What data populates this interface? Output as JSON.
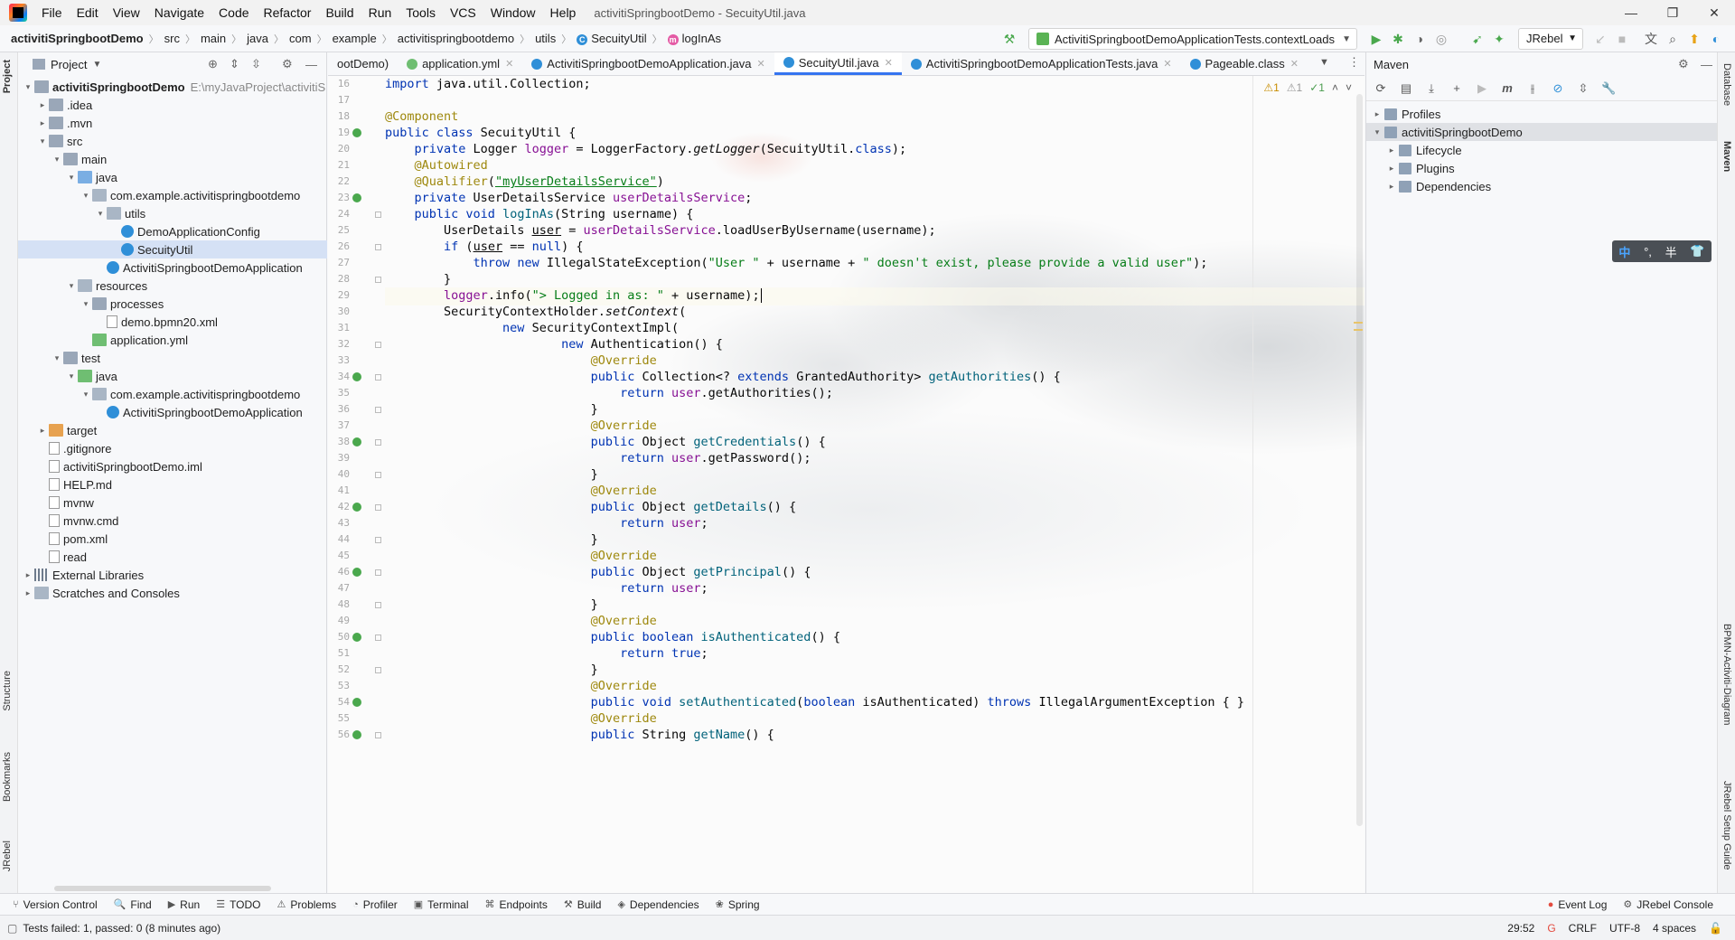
{
  "menubar": {
    "items": [
      "File",
      "Edit",
      "View",
      "Navigate",
      "Code",
      "Refactor",
      "Build",
      "Run",
      "Tools",
      "VCS",
      "Window",
      "Help"
    ],
    "title": "activitiSpringbootDemo - SecuityUtil.java",
    "win_min": "—",
    "win_max": "❐",
    "win_close": "✕"
  },
  "navbar": {
    "crumbs": [
      "activitiSpringbootDemo",
      "src",
      "main",
      "java",
      "com",
      "example",
      "activitispringbootdemo",
      "utils",
      "SecuityUtil",
      "logInAs"
    ],
    "run_config": "ActivitiSpringbootDemoApplicationTests.contextLoads",
    "jrebel": "JRebel"
  },
  "left_stripe": {
    "project": "Project",
    "structure": "Structure",
    "bookmarks": "Bookmarks",
    "jrebel": "JRebel"
  },
  "project": {
    "title": "Project",
    "tree": [
      {
        "label": "activitiSpringbootDemo",
        "extra": "E:\\myJavaProject\\activitiS",
        "indent": 0,
        "arrow": "▾",
        "icon": "f-folder",
        "bold": true
      },
      {
        "label": ".idea",
        "indent": 1,
        "arrow": "▸",
        "icon": "f-folder"
      },
      {
        "label": ".mvn",
        "indent": 1,
        "arrow": "▸",
        "icon": "f-folder"
      },
      {
        "label": "src",
        "indent": 1,
        "arrow": "▾",
        "icon": "f-folder"
      },
      {
        "label": "main",
        "indent": 2,
        "arrow": "▾",
        "icon": "f-folder"
      },
      {
        "label": "java",
        "indent": 3,
        "arrow": "▾",
        "icon": "f-src"
      },
      {
        "label": "com.example.activitispringbootdemo",
        "indent": 4,
        "arrow": "▾",
        "icon": "f-pkg"
      },
      {
        "label": "utils",
        "indent": 5,
        "arrow": "▾",
        "icon": "f-pkg"
      },
      {
        "label": "DemoApplicationConfig",
        "indent": 6,
        "arrow": "",
        "icon": "f-cls"
      },
      {
        "label": "SecuityUtil",
        "indent": 6,
        "arrow": "",
        "icon": "f-cls",
        "selected": true
      },
      {
        "label": "ActivitiSpringbootDemoApplication",
        "indent": 5,
        "arrow": "",
        "icon": "f-cls"
      },
      {
        "label": "resources",
        "indent": 3,
        "arrow": "▾",
        "icon": "f-pkg"
      },
      {
        "label": "processes",
        "indent": 4,
        "arrow": "▾",
        "icon": "f-folder"
      },
      {
        "label": "demo.bpmn20.xml",
        "indent": 5,
        "arrow": "",
        "icon": "f-file"
      },
      {
        "label": "application.yml",
        "indent": 4,
        "arrow": "",
        "icon": "f-green"
      },
      {
        "label": "test",
        "indent": 2,
        "arrow": "▾",
        "icon": "f-folder"
      },
      {
        "label": "java",
        "indent": 3,
        "arrow": "▾",
        "icon": "f-green"
      },
      {
        "label": "com.example.activitispringbootdemo",
        "indent": 4,
        "arrow": "▾",
        "icon": "f-pkg"
      },
      {
        "label": "ActivitiSpringbootDemoApplication",
        "indent": 5,
        "arrow": "",
        "icon": "f-cls"
      },
      {
        "label": "target",
        "indent": 1,
        "arrow": "▸",
        "icon": "f-orange"
      },
      {
        "label": ".gitignore",
        "indent": 1,
        "arrow": "",
        "icon": "f-file"
      },
      {
        "label": "activitiSpringbootDemo.iml",
        "indent": 1,
        "arrow": "",
        "icon": "f-file"
      },
      {
        "label": "HELP.md",
        "indent": 1,
        "arrow": "",
        "icon": "f-file"
      },
      {
        "label": "mvnw",
        "indent": 1,
        "arrow": "",
        "icon": "f-file"
      },
      {
        "label": "mvnw.cmd",
        "indent": 1,
        "arrow": "",
        "icon": "f-file"
      },
      {
        "label": "pom.xml",
        "indent": 1,
        "arrow": "",
        "icon": "f-file"
      },
      {
        "label": "read",
        "indent": 1,
        "arrow": "",
        "icon": "f-file"
      },
      {
        "label": "External Libraries",
        "indent": 0,
        "arrow": "▸",
        "icon": "f-lib"
      },
      {
        "label": "Scratches and Consoles",
        "indent": 0,
        "arrow": "▸",
        "icon": "f-pkg"
      }
    ]
  },
  "tabs": [
    {
      "label": "ootDemo)",
      "color": "",
      "active": false,
      "close": false
    },
    {
      "label": "application.yml",
      "color": "#6fbe72",
      "active": false,
      "close": true
    },
    {
      "label": "ActivitiSpringbootDemoApplication.java",
      "color": "#2f8fd8",
      "active": false,
      "close": true
    },
    {
      "label": "SecuityUtil.java",
      "color": "#2f8fd8",
      "active": true,
      "close": true
    },
    {
      "label": "ActivitiSpringbootDemoApplicationTests.java",
      "color": "#2f8fd8",
      "active": false,
      "close": true
    },
    {
      "label": "Pageable.class",
      "color": "#2f8fd8",
      "active": false,
      "close": true
    }
  ],
  "inspections": {
    "warn1": "⚠1",
    "warn2": "⚠1",
    "ok": "✓1"
  },
  "editor": {
    "lines": [
      {
        "n": "16",
        "html": "<span class=\"kw\">import</span> java.util.Collection;"
      },
      {
        "n": "17",
        "html": ""
      },
      {
        "n": "18",
        "html": "<span class=\"an\">@Component</span>"
      },
      {
        "n": "19",
        "html": "<span class=\"kw\">public class</span> SecuityUtil {",
        "mark": "#4aa84d"
      },
      {
        "n": "20",
        "html": "    <span class=\"kw\">private</span> Logger <span class=\"fd\">logger</span> = LoggerFactory.<span class=\"it\">getLogger</span>(SecuityUtil.<span class=\"kw\">class</span>);"
      },
      {
        "n": "21",
        "html": "    <span class=\"an\">@Autowired</span>"
      },
      {
        "n": "22",
        "html": "    <span class=\"an\">@Qualifier</span>(<span class=\"st ul\">\"myUserDetailsService\"</span>)"
      },
      {
        "n": "23",
        "html": "    <span class=\"kw\">private</span> UserDetailsService <span class=\"fd\">userDetailsService</span>;",
        "mark": "#4aa84d"
      },
      {
        "n": "24",
        "html": "    <span class=\"kw\">public void</span> <span class=\"fn\">logInAs</span>(String username) {",
        "fold": true
      },
      {
        "n": "25",
        "html": "        UserDetails <span class=\"ul\">user</span> = <span class=\"fd\">userDetailsService</span>.loadUserByUsername(username);"
      },
      {
        "n": "26",
        "html": "        <span class=\"kw\">if</span> (<span class=\"ul\">user</span> == <span class=\"kw\">null</span>) {",
        "fold": true
      },
      {
        "n": "27",
        "html": "            <span class=\"kw\">throw new</span> IllegalStateException(<span class=\"st\">\"User \"</span> + username + <span class=\"st\">\" doesn't exist, please provide a valid user\"</span>);"
      },
      {
        "n": "28",
        "html": "        }",
        "fold": true
      },
      {
        "n": "29",
        "html": "        <span class=\"fd\">logger</span>.info(<span class=\"st\">\"> Logged in as: \"</span> + username);",
        "caret": true
      },
      {
        "n": "30",
        "html": "        SecurityContextHolder.<span class=\"it\">setContext</span>("
      },
      {
        "n": "31",
        "html": "                <span class=\"kw\">new</span> SecurityContextImpl("
      },
      {
        "n": "32",
        "html": "                        <span class=\"kw\">new</span> Authentication() {",
        "fold": true
      },
      {
        "n": "33",
        "html": "                            <span class=\"an\">@Override</span>"
      },
      {
        "n": "34",
        "html": "                            <span class=\"kw\">public</span> Collection&lt;? <span class=\"kw\">extends</span> GrantedAuthority&gt; <span class=\"fn\">getAuthorities</span>() {",
        "mark": "#4aa84d",
        "fold": true
      },
      {
        "n": "35",
        "html": "                                <span class=\"kw\">return</span> <span class=\"fd\">user</span>.getAuthorities();"
      },
      {
        "n": "36",
        "html": "                            }",
        "fold": true
      },
      {
        "n": "37",
        "html": "                            <span class=\"an\">@Override</span>"
      },
      {
        "n": "38",
        "html": "                            <span class=\"kw\">public</span> Object <span class=\"fn\">getCredentials</span>() {",
        "mark": "#4aa84d",
        "fold": true
      },
      {
        "n": "39",
        "html": "                                <span class=\"kw\">return</span> <span class=\"fd\">user</span>.getPassword();"
      },
      {
        "n": "40",
        "html": "                            }",
        "fold": true
      },
      {
        "n": "41",
        "html": "                            <span class=\"an\">@Override</span>"
      },
      {
        "n": "42",
        "html": "                            <span class=\"kw\">public</span> Object <span class=\"fn\">getDetails</span>() {",
        "mark": "#4aa84d",
        "fold": true
      },
      {
        "n": "43",
        "html": "                                <span class=\"kw\">return</span> <span class=\"fd\">user</span>;"
      },
      {
        "n": "44",
        "html": "                            }",
        "fold": true
      },
      {
        "n": "45",
        "html": "                            <span class=\"an\">@Override</span>"
      },
      {
        "n": "46",
        "html": "                            <span class=\"kw\">public</span> Object <span class=\"fn\">getPrincipal</span>() {",
        "mark": "#4aa84d",
        "fold": true
      },
      {
        "n": "47",
        "html": "                                <span class=\"kw\">return</span> <span class=\"fd\">user</span>;"
      },
      {
        "n": "48",
        "html": "                            }",
        "fold": true
      },
      {
        "n": "49",
        "html": "                            <span class=\"an\">@Override</span>"
      },
      {
        "n": "50",
        "html": "                            <span class=\"kw\">public boolean</span> <span class=\"fn\">isAuthenticated</span>() {",
        "mark": "#4aa84d",
        "fold": true
      },
      {
        "n": "51",
        "html": "                                <span class=\"kw\">return true</span>;"
      },
      {
        "n": "52",
        "html": "                            }",
        "fold": true
      },
      {
        "n": "53",
        "html": "                            <span class=\"an\">@Override</span>"
      },
      {
        "n": "54",
        "html": "                            <span class=\"kw\">public void</span> <span class=\"fn\">setAuthenticated</span>(<span class=\"kw\">boolean</span> isAuthenticated) <span class=\"kw\">throws</span> IllegalArgumentException { }",
        "mark": "#4aa84d"
      },
      {
        "n": "55",
        "html": "                            <span class=\"an\">@Override</span>"
      },
      {
        "n": "56",
        "html": "                            <span class=\"kw\">public</span> String <span class=\"fn\">getName</span>() {",
        "mark": "#4aa84d",
        "fold": true
      }
    ]
  },
  "maven": {
    "title": "Maven",
    "tree": [
      {
        "label": "Profiles",
        "indent": 0,
        "arrow": "▸"
      },
      {
        "label": "activitiSpringbootDemo",
        "indent": 0,
        "arrow": "▾",
        "selected": true
      },
      {
        "label": "Lifecycle",
        "indent": 1,
        "arrow": "▸"
      },
      {
        "label": "Plugins",
        "indent": 1,
        "arrow": "▸"
      },
      {
        "label": "Dependencies",
        "indent": 1,
        "arrow": "▸"
      }
    ]
  },
  "ime": {
    "lang": "中",
    "punct": "°,",
    "width": "半"
  },
  "right_stripe": {
    "database": "Database",
    "maven": "Maven",
    "bpmn": "BPMN-Activiti-Diagram",
    "jrebel_guide": "JRebel Setup Guide"
  },
  "bottom_tools": [
    {
      "icon": "⑂",
      "label": "Version Control"
    },
    {
      "icon": "🔍",
      "label": "Find"
    },
    {
      "icon": "▶",
      "label": "Run"
    },
    {
      "icon": "☰",
      "label": "TODO"
    },
    {
      "icon": "⚠",
      "label": "Problems"
    },
    {
      "icon": "◔",
      "label": "Profiler"
    },
    {
      "icon": "▣",
      "label": "Terminal"
    },
    {
      "icon": "⌘",
      "label": "Endpoints"
    },
    {
      "icon": "⚒",
      "label": "Build"
    },
    {
      "icon": "◈",
      "label": "Dependencies"
    },
    {
      "icon": "❀",
      "label": "Spring"
    }
  ],
  "bottom_right_tools": [
    {
      "icon": "●",
      "label": "Event Log"
    },
    {
      "icon": "⚙",
      "label": "JRebel Console"
    }
  ],
  "status": {
    "message": "Tests failed: 1, passed: 0 (8 minutes ago)",
    "position": "29:52",
    "line_sep": "CRLF",
    "encoding": "UTF-8",
    "indent": "4 spaces"
  }
}
